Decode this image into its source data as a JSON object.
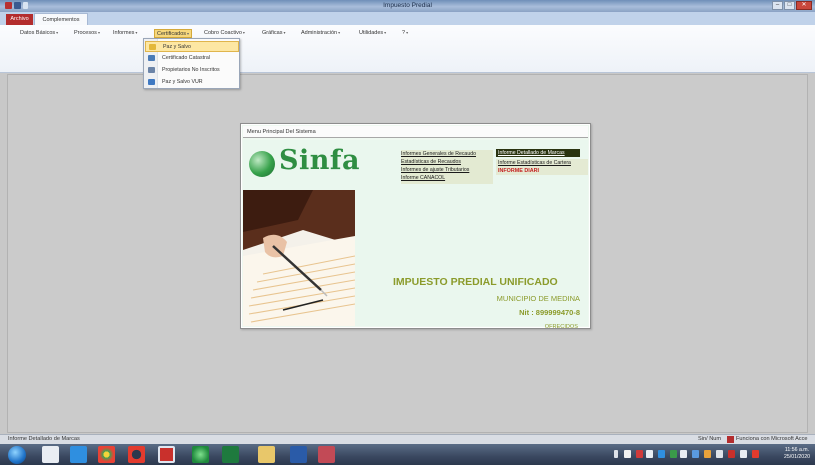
{
  "window": {
    "title": "Impuesto Predial",
    "minimize": "–",
    "maximize": "□",
    "close": "✕"
  },
  "ribbon_tabs": {
    "archivo": "Archivo",
    "complementos": "Complementos"
  },
  "menus": [
    {
      "label": "Datos Básicos",
      "arrow": "▾"
    },
    {
      "label": "Procesos",
      "arrow": "▾"
    },
    {
      "label": "Informes",
      "arrow": "▾"
    },
    {
      "label": "Certificados",
      "arrow": "▾"
    },
    {
      "label": "Cobro Coactivo",
      "arrow": "▾"
    },
    {
      "label": "Gráficas",
      "arrow": "▾"
    },
    {
      "label": "Administración",
      "arrow": "▾"
    },
    {
      "label": "Utilidades",
      "arrow": "▾"
    },
    {
      "label": "?",
      "arrow": "▾"
    }
  ],
  "certificados_dropdown": [
    {
      "label": "Paz y Salvo",
      "icon": "certificate-icon"
    },
    {
      "label": "Certificado Catastral",
      "icon": "document-icon"
    },
    {
      "label": "Propietarios No Inscritos",
      "icon": "people-icon"
    },
    {
      "label": "Paz y Salvo VUR",
      "icon": "certificate-vur-icon"
    }
  ],
  "panel": {
    "title": "Menu Principal Del Sistema",
    "logo_text": "Sinfa",
    "links_left": [
      "Informes Generales de Recaudo",
      "Estadísticas de Recaudos",
      "Informes de ajuste Tributarios",
      "Informe CANACOL"
    ],
    "links_right": [
      "Informe Detallado de Marcas",
      "Informe Estadísticas de Cartera"
    ],
    "informe_diario": "INFORME DIARI",
    "main_title": "IMPUESTO PREDIAL UNIFICADO",
    "municipio": "MUNICIPIO DE MEDINA",
    "nit": "Nit : 899999470-8",
    "ofrecidos": "OFRECIDOS"
  },
  "statusbar": {
    "left": "Informe Detallado de Marcas",
    "mode": "Sin/ Num",
    "access": "Funciona con Microsoft Acce"
  },
  "clock": {
    "time": "11:56 a.m.",
    "date": "25/01/2020"
  },
  "colors": {
    "archivo_tab": "#b32d2e",
    "logo_green": "#2f8e42",
    "title_olive": "#8b9b2b",
    "alert_red": "#c41f1f",
    "menu_highlight": "#f6d77c"
  }
}
